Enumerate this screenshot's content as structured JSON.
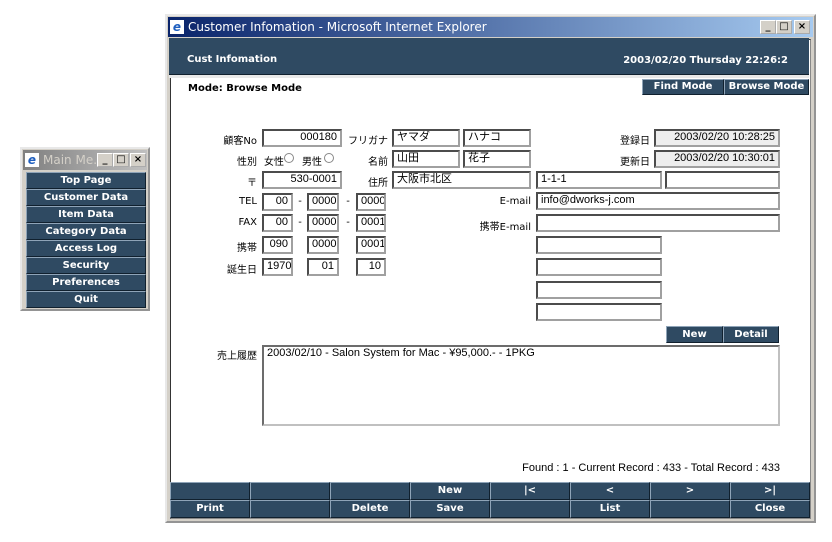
{
  "main_window": {
    "title": "Customer Infomation - Microsoft Internet Explorer",
    "header_title": "Cust Infomation",
    "datetime": "2003/02/20 Thursday 22:26:2",
    "mode": "Mode: Browse Mode",
    "find_mode": "Find Mode",
    "browse_mode": "Browse Mode"
  },
  "form": {
    "customer_no": {
      "label": "顧客No",
      "value": "000180"
    },
    "furigana": {
      "label": "フリガナ",
      "last": "ヤマダ",
      "first": "ハナコ"
    },
    "registered": {
      "label": "登録日",
      "value": "2003/02/20 10:28:25"
    },
    "gender": {
      "label": "性別",
      "female": "女性",
      "male": "男性"
    },
    "name": {
      "label": "名前",
      "last": "山田",
      "first": "花子"
    },
    "updated": {
      "label": "更新日",
      "value": "2003/02/20 10:30:01"
    },
    "zip": {
      "label": "〒",
      "value": "530-0001"
    },
    "address": {
      "label": "住所",
      "a1": "大阪市北区",
      "a2": "1-1-1",
      "a3": ""
    },
    "tel": {
      "label": "TEL",
      "p1": "00",
      "p2": "0000",
      "p3": "0000"
    },
    "fax": {
      "label": "FAX",
      "p1": "00",
      "p2": "0000",
      "p3": "0001"
    },
    "mobile": {
      "label": "携帯",
      "p1": "090",
      "p2": "0000",
      "p3": "0001"
    },
    "birthday": {
      "label": "誕生日",
      "year": "1970",
      "month": "01",
      "day": "10"
    },
    "email": {
      "label": "E-mail",
      "value": "info@dworks-j.com"
    },
    "mobile_email": {
      "label": "携帯E-mail",
      "value": ""
    },
    "dash": "-",
    "sales": {
      "label": "売上履歴",
      "value": "2003/02/10 - Salon System for Mac - ¥95,000.- - 1PKG",
      "new": "New",
      "detail": "Detail"
    }
  },
  "status": "Found : 1 - Current Record : 433 - Total Record : 433",
  "toolbar": {
    "row1": [
      "",
      "",
      "",
      "New",
      "|<",
      "<",
      ">",
      ">|"
    ],
    "row2": [
      "Print",
      "",
      "Delete",
      "Save",
      "",
      "List",
      "",
      "Close"
    ]
  },
  "menu_window": {
    "title": "Main Me...",
    "items": [
      "Top Page",
      "Customer Data",
      "Item Data",
      "Category Data",
      "Access Log",
      "Security",
      "Preferences",
      "Quit"
    ]
  }
}
